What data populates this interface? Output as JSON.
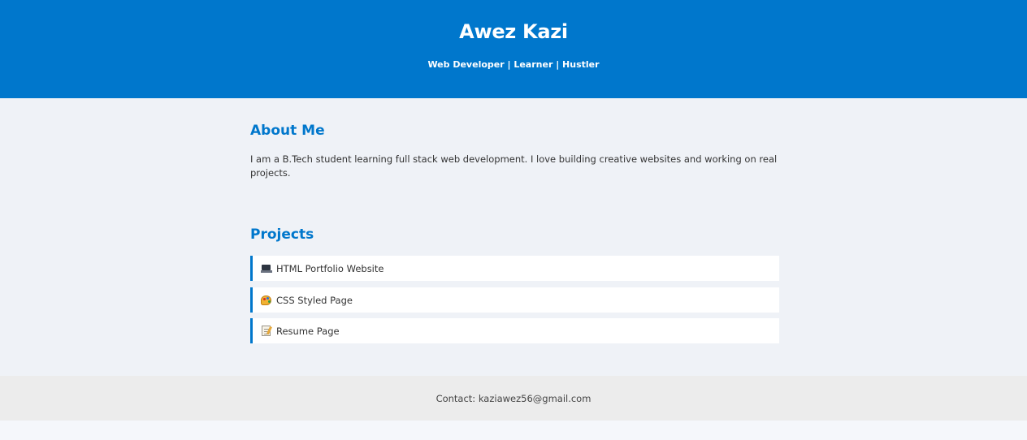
{
  "header": {
    "name": "Awez Kazi",
    "tagline": "Web Developer | Learner | Hustler"
  },
  "about": {
    "heading": "About Me",
    "text": "I am a B.Tech student learning full stack web development. I love building creative websites and working on real projects."
  },
  "projects": {
    "heading": "Projects",
    "items": [
      {
        "icon": "laptop-icon",
        "label": "HTML Portfolio Website"
      },
      {
        "icon": "palette-icon",
        "label": "CSS Styled Page"
      },
      {
        "icon": "memo-icon",
        "label": "Resume Page"
      }
    ]
  },
  "footer": {
    "contact": "Contact: kaziawez56@gmail.com"
  },
  "colors": {
    "accent": "#0077cc",
    "background": "#eff2f7",
    "footer_background": "#ececec"
  }
}
